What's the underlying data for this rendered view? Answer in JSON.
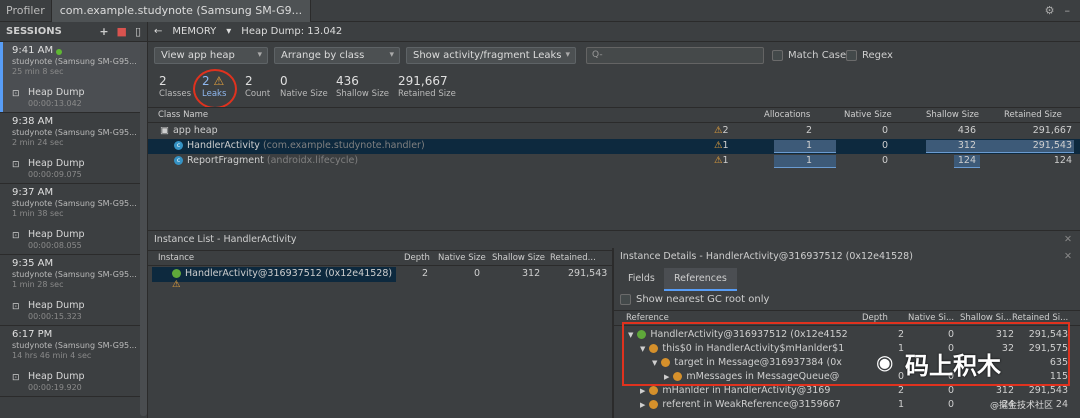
{
  "topbar": {
    "title": "Profiler",
    "tab": "com.example.studynote (Samsung SM-G9..."
  },
  "sessions": {
    "header": "SESSIONS",
    "items": [
      {
        "time": "9:41 AM",
        "device": "studynote (Samsung SM-G95...",
        "duration": "25 min 8 sec",
        "dump_label": "Heap Dump",
        "dump_time": "00:00:13.042",
        "active": true
      },
      {
        "time": "9:38 AM",
        "device": "studynote (Samsung SM-G95...",
        "duration": "2 min 24 sec",
        "dump_label": "Heap Dump",
        "dump_time": "00:00:09.075"
      },
      {
        "time": "9:37 AM",
        "device": "studynote (Samsung SM-G95...",
        "duration": "1 min 38 sec",
        "dump_label": "Heap Dump",
        "dump_time": "00:00:08.055"
      },
      {
        "time": "9:35 AM",
        "device": "studynote (Samsung SM-G95...",
        "duration": "1 min 28 sec",
        "dump_label": "Heap Dump",
        "dump_time": "00:00:15.323"
      },
      {
        "time": "6:17 PM",
        "device": "studynote (Samsung SM-G95...",
        "duration": "14 hrs 46 min 4 sec",
        "dump_label": "Heap Dump",
        "dump_time": "00:00:19.920"
      }
    ]
  },
  "toolbar": {
    "memory": "MEMORY",
    "heap_dump": "Heap Dump: 13.042"
  },
  "filters": {
    "heap": "View app heap",
    "arrange": "Arrange by class",
    "leaks": "Show activity/fragment Leaks",
    "search_placeholder": "Q-",
    "match_case": "Match Case",
    "regex": "Regex"
  },
  "stats": [
    {
      "value": "2",
      "label": "Classes"
    },
    {
      "value": "2",
      "label": "Leaks"
    },
    {
      "value": "2",
      "label": "Count"
    },
    {
      "value": "0",
      "label": "Native Size"
    },
    {
      "value": "436",
      "label": "Shallow Size"
    },
    {
      "value": "291,667",
      "label": "Retained Size"
    }
  ],
  "class_table": {
    "headers": [
      "Class Name",
      "Allocations",
      "Native Size",
      "Shallow Size",
      "Retained Size"
    ],
    "rows": [
      {
        "name": "app heap",
        "pkg": "",
        "warn": "2",
        "alloc": "2",
        "native": "0",
        "shallow": "436",
        "retained": "291,667"
      },
      {
        "name": "HandlerActivity",
        "pkg": "(com.example.studynote.handler)",
        "warn": "1",
        "alloc": "1",
        "native": "0",
        "shallow": "312",
        "retained": "291,543"
      },
      {
        "name": "ReportFragment",
        "pkg": "(androidx.lifecycle)",
        "warn": "1",
        "alloc": "1",
        "native": "0",
        "shallow": "124",
        "retained": "124"
      }
    ]
  },
  "instance_list": {
    "title": "Instance List - HandlerActivity",
    "headers": [
      "Instance",
      "Depth",
      "Native Size",
      "Shallow Size",
      "Retained..."
    ],
    "rows": [
      {
        "name": "HandlerActivity@316937512 (0x12e41528)",
        "depth": "2",
        "native": "0",
        "shallow": "312",
        "retained": "291,543"
      }
    ]
  },
  "instance_details": {
    "title": "Instance Details - HandlerActivity@316937512 (0x12e41528)",
    "tabs": [
      "Fields",
      "References"
    ],
    "gc_root": "Show nearest GC root only",
    "headers": [
      "Reference",
      "Depth",
      "Native Si...",
      "Shallow Si...",
      "Retained Si..."
    ],
    "rows": [
      {
        "name": "HandlerActivity@316937512 (0x12e4152",
        "depth": "2",
        "native": "0",
        "shallow": "312",
        "retained": "291,543"
      },
      {
        "name": "this$0 in HandlerActivity$mHanlder$1",
        "depth": "1",
        "native": "0",
        "shallow": "32",
        "retained": "291,575"
      },
      {
        "name": "target in Message@316937384 (0x",
        "depth": "",
        "native": "",
        "shallow": "",
        "retained": "635"
      },
      {
        "name": "mMessages in MessageQueue@",
        "depth": "0",
        "native": "0",
        "shallow": "",
        "retained": "115"
      },
      {
        "name": "mHanlder in HandlerActivity@3169",
        "depth": "2",
        "native": "0",
        "shallow": "312",
        "retained": "291,543"
      },
      {
        "name": "referent in WeakReference@3159667",
        "depth": "1",
        "native": "0",
        "shallow": "24",
        "retained": "24"
      }
    ]
  },
  "watermark": {
    "text": "码上积木",
    "small": "@掘金技术社区"
  }
}
